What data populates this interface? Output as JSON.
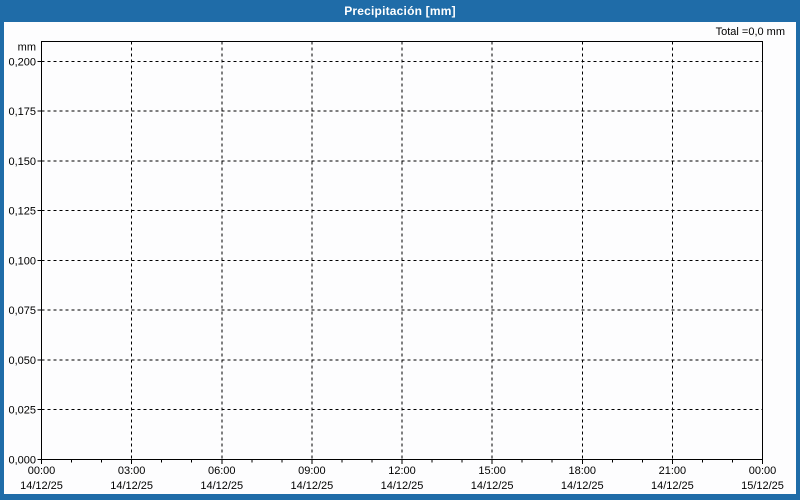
{
  "window": {
    "title": "Precipitación [mm]"
  },
  "colors": {
    "titlebar": "#1f6ca8",
    "frame_border": "#1f6ca8",
    "title_text": "#ffffff",
    "axis": "#000000",
    "labels": "#000000",
    "background": "#fdfdfe"
  },
  "chart_data": {
    "type": "line",
    "title": "Precipitación [mm]",
    "total_label": "Total =0,0 mm",
    "total_value_mm": 0.0,
    "xlabel": "",
    "ylabel": "mm",
    "ylim": [
      0,
      0.21
    ],
    "grid": "dashed",
    "legend_position": "none",
    "y_ticks": [
      {
        "label": "0,200",
        "value": 0.2
      },
      {
        "label": "0,175",
        "value": 0.175
      },
      {
        "label": "0,150",
        "value": 0.15
      },
      {
        "label": "0,125",
        "value": 0.125
      },
      {
        "label": "0,100",
        "value": 0.1
      },
      {
        "label": "0,075",
        "value": 0.075
      },
      {
        "label": "0,050",
        "value": 0.05
      },
      {
        "label": "0,025",
        "value": 0.025
      },
      {
        "label": "0,000",
        "value": 0.0
      }
    ],
    "x_ticks": [
      {
        "time": "00:00",
        "date": "14/12/25"
      },
      {
        "time": "03:00",
        "date": "14/12/25"
      },
      {
        "time": "06:00",
        "date": "14/12/25"
      },
      {
        "time": "09:00",
        "date": "14/12/25"
      },
      {
        "time": "12:00",
        "date": "14/12/25"
      },
      {
        "time": "15:00",
        "date": "14/12/25"
      },
      {
        "time": "18:00",
        "date": "14/12/25"
      },
      {
        "time": "21:00",
        "date": "14/12/25"
      },
      {
        "time": "00:00",
        "date": "15/12/25"
      }
    ],
    "hours_per_major_tick": 3,
    "series": []
  }
}
